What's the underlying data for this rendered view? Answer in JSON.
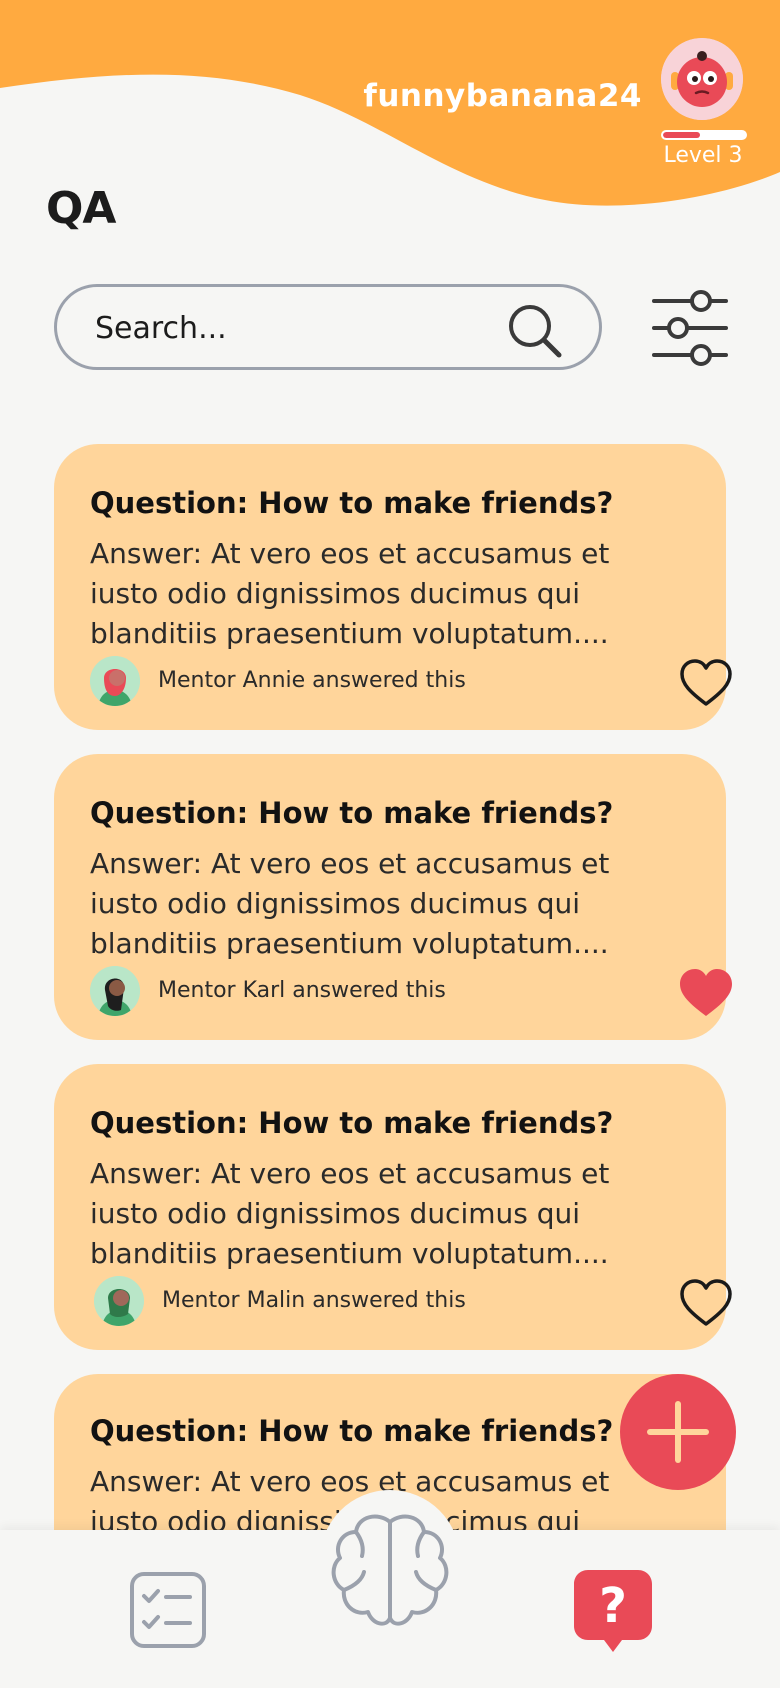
{
  "header": {
    "username": "funnybanana24",
    "level_label": "Level 3",
    "level_progress": 0.45,
    "avatar_icon": "monkey-avatar-icon"
  },
  "page_title": "QA",
  "search": {
    "placeholder": "Search..."
  },
  "filter_icon": "sliders-filter-icon",
  "questions": [
    {
      "question": "Question: How to make friends?",
      "answer": "Answer: At vero eos et accusamus et iusto odio dignissimos ducimus qui blanditiis praesentium voluptatum....",
      "mentor_text": "Mentor Annie answered this",
      "liked": false
    },
    {
      "question": "Question: How to make friends?",
      "answer": "Answer: At vero eos et accusamus et iusto odio dignissimos ducimus qui blanditiis praesentium voluptatum....",
      "mentor_text": "Mentor Karl answered this",
      "liked": true
    },
    {
      "question": "Question: How to make friends?",
      "answer": "Answer: At vero eos et accusamus et iusto odio dignissimos ducimus qui blanditiis praesentium voluptatum....",
      "mentor_text": "Mentor Malin answered this",
      "liked": false
    },
    {
      "question": "Question: How to make friends?",
      "answer": "Answer: At vero eos et accusamus et iusto odio dignissimos ducimus qui"
    }
  ],
  "fab_icon": "plus-icon",
  "nav": {
    "items": [
      {
        "icon": "checklist-icon",
        "active": false
      },
      {
        "icon": "brain-icon",
        "active": false
      },
      {
        "icon": "question-bubble-icon",
        "active": true
      }
    ]
  },
  "colors": {
    "header_orange": "#FFAA40",
    "card_bg": "#FFD59B",
    "accent_red": "#E94A57",
    "page_bg": "#F6F6F4",
    "icon_gray": "#9BA1AC"
  }
}
